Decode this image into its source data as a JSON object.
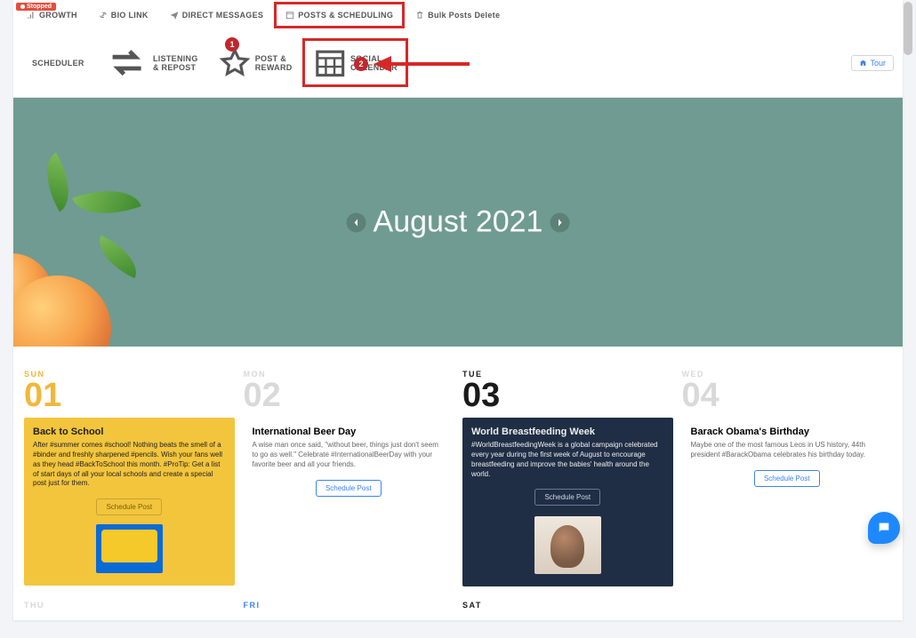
{
  "status_badge": "Stopped",
  "topnav": {
    "growth": "GROWTH",
    "biolink": "BIO LINK",
    "dm": "DIRECT MESSAGES",
    "posts": "POSTS & SCHEDULING",
    "bulkdel": "Bulk Posts Delete"
  },
  "subnav": {
    "scheduler": "SCHEDULER",
    "listening": "LISTENING & REPOST",
    "postreward": "POST & REWARD",
    "socialcal": "SOCIAL CALENDAR"
  },
  "tour": "Tour",
  "hero": {
    "month_label": "August 2021"
  },
  "annotation": {
    "badge1": "1",
    "badge2": "2"
  },
  "days": [
    {
      "dow": "SUN",
      "num": "01",
      "title": "Back to School",
      "desc": "After #summer comes #school! Nothing beats the smell of a #binder and freshly sharpened #pencils. Wish your fans well as they head #BackToSchool this month. #ProTip: Get a list of start days of all your local schools and create a special post just for them.",
      "btn": "Schedule Post"
    },
    {
      "dow": "MON",
      "num": "02",
      "title": "International Beer Day",
      "desc": "A wise man once said, \"without beer, things just don't seem to go as well.\" Celebrate #InternationalBeerDay with your favorite beer and all your friends.",
      "btn": "Schedule Post"
    },
    {
      "dow": "TUE",
      "num": "03",
      "title": "World Breastfeeding Week",
      "desc": "#WorldBreastfeedingWeek is a global campaign celebrated every year during the first week of August to encourage breastfeeding and improve the babies' health around the world.",
      "btn": "Schedule Post"
    },
    {
      "dow": "WED",
      "num": "04",
      "title": "Barack Obama's Birthday",
      "desc": "Maybe one of the most famous Leos in US history, 44th president #BarackObama celebrates his birthday today.",
      "btn": "Schedule Post"
    }
  ],
  "week2": {
    "thu": "THU",
    "fri": "FRI",
    "sat": "SAT"
  }
}
